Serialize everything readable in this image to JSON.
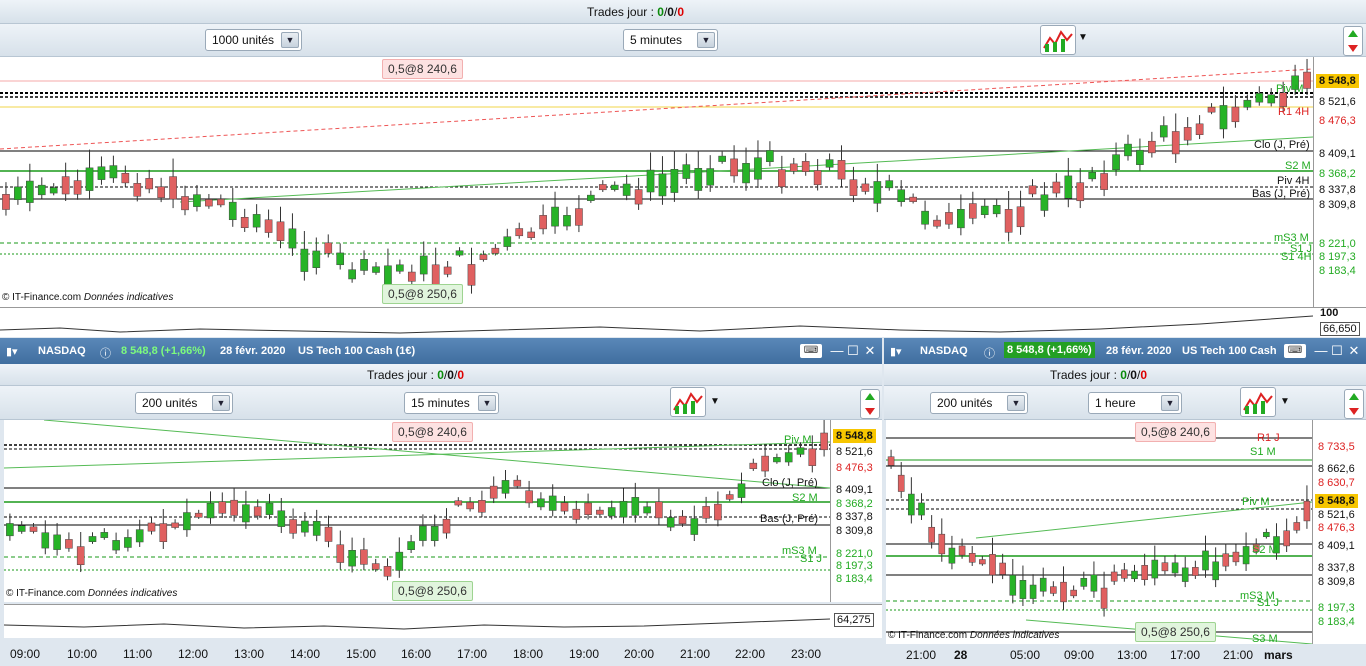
{
  "main": {
    "trades_label": "Trades jour :",
    "trades": [
      "0",
      "0",
      "0"
    ],
    "sep": "/",
    "units": "1000 unités",
    "interval": "5 minutes",
    "order_sell": "0,5@8 240,6",
    "order_buy": "0,5@8 250,6",
    "credit": "© IT-Finance.com",
    "indicative": "Données indicatives",
    "price_last": "8 548,8",
    "prices": [
      "8 521,6",
      "8 476,3",
      "8 409,1",
      "8 368,2",
      "8 337,8",
      "8 309,8",
      "8 221,0",
      "8 197,3",
      "8 183,4"
    ],
    "levels": [
      "R1 4H",
      "Clo (J, Pré)",
      "S2 M",
      "Piv 4H",
      "Bas (J, Pré)",
      "mS3 M",
      "S1 J",
      "S1 4H",
      "Piv M"
    ],
    "osc_top": "100",
    "osc_val": "66,650"
  },
  "left": {
    "symbol": "NASDAQ",
    "quote": "8 548,8 (+1,66%)",
    "date": "28 févr. 2020",
    "name": "US Tech 100 Cash (1€)",
    "trades_label": "Trades jour :",
    "trades": [
      "0",
      "0",
      "0"
    ],
    "units": "200 unités",
    "interval": "15 minutes",
    "order_sell": "0,5@8 240,6",
    "order_buy": "0,5@8 250,6",
    "credit": "© IT-Finance.com",
    "indicative": "Données indicatives",
    "price_last": "8 548,8",
    "prices": [
      "8 521,6",
      "8 476,3",
      "8 409,1",
      "8 368,2",
      "8 337,8",
      "8 309,8",
      "8 221,0",
      "8 197,3",
      "8 183,4"
    ],
    "levels": [
      "Piv M",
      "Clo (J, Pré)",
      "S2 M",
      "Bas (J, Pré)",
      "mS3 M",
      "S1 J"
    ],
    "osc_val": "64,275",
    "times": [
      "09:00",
      "10:00",
      "11:00",
      "12:00",
      "13:00",
      "14:00",
      "15:00",
      "16:00",
      "17:00",
      "18:00",
      "19:00",
      "20:00",
      "21:00",
      "22:00",
      "23:00"
    ]
  },
  "right": {
    "symbol": "NASDAQ",
    "quote": "8 548,8 (+1,66%)",
    "date": "28 févr. 2020",
    "name": "US Tech 100 Cash",
    "trades_label": "Trades jour :",
    "trades": [
      "0",
      "0",
      "0"
    ],
    "units": "200 unités",
    "interval": "1 heure",
    "order_sell": "0,5@8 240,6",
    "order_buy": "0,5@8 250,6",
    "credit": "© IT-Finance.com",
    "indicative": "Données indicatives",
    "price_last": "8 548,8",
    "prices": [
      "8 733,5",
      "8 662,6",
      "8 630,7",
      "8 521,6",
      "8 476,3",
      "8 409,1",
      "8 337,8",
      "8 309,8",
      "8 197,3",
      "8 183,4"
    ],
    "levels": [
      "R1 J",
      "S1 M",
      "Piv M",
      "S2 M",
      "mS3 M",
      "S1 J",
      "S3 M"
    ],
    "times": [
      "21:00",
      "28",
      "05:00",
      "09:00",
      "13:00",
      "17:00",
      "21:00",
      "mars"
    ]
  },
  "colors": {
    "up": "#27b327",
    "down": "#e06060",
    "accent": "#3f6e9f"
  }
}
